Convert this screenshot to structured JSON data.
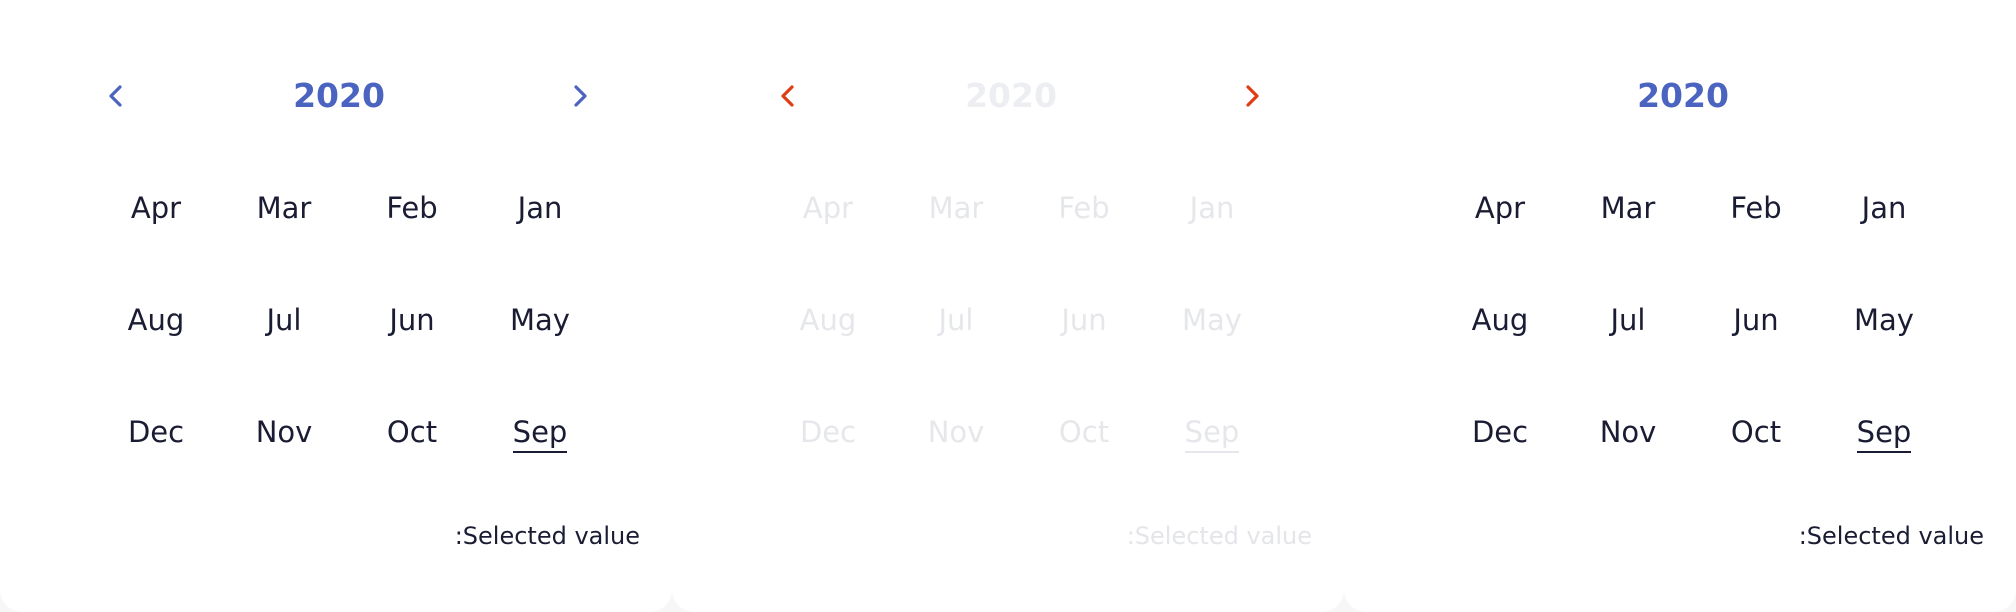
{
  "colors": {
    "accent": "#4b64c0",
    "error": "#e03d12",
    "text": "#1a1c33",
    "disabled_text": "#e6e7eb"
  },
  "icons": {
    "prev": "chevron-left-icon",
    "next": "chevron-right-icon"
  },
  "pickers": [
    {
      "state": "default",
      "year": "2020",
      "months": [
        "Apr",
        "Mar",
        "Feb",
        "Jan",
        "Aug",
        "Jul",
        "Jun",
        "May",
        "Dec",
        "Nov",
        "Oct",
        "Sep"
      ],
      "selected_month": "Sep",
      "selected_label": ":Selected value"
    },
    {
      "state": "disabled-error",
      "year": "2020",
      "months": [
        "Apr",
        "Mar",
        "Feb",
        "Jan",
        "Aug",
        "Jul",
        "Jun",
        "May",
        "Dec",
        "Nov",
        "Oct",
        "Sep"
      ],
      "selected_month": "Sep",
      "selected_label": ":Selected value"
    },
    {
      "state": "no-navigation",
      "year": "2020",
      "months": [
        "Apr",
        "Mar",
        "Feb",
        "Jan",
        "Aug",
        "Jul",
        "Jun",
        "May",
        "Dec",
        "Nov",
        "Oct",
        "Sep"
      ],
      "selected_month": "Sep",
      "selected_label": ":Selected value"
    }
  ]
}
